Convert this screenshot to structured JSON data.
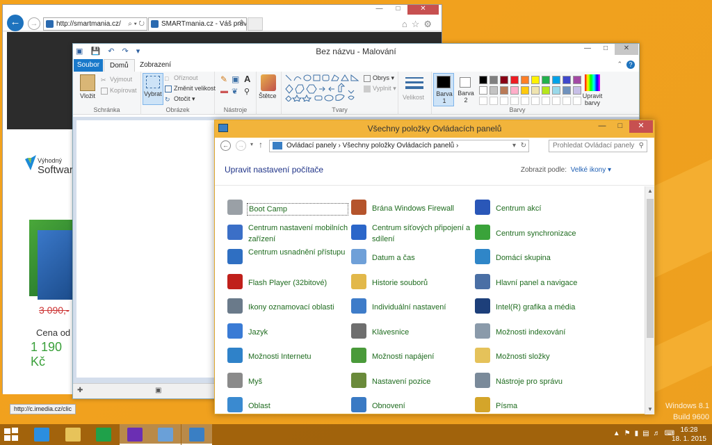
{
  "ie": {
    "address": "http://smartmania.cz/",
    "tab_title": "SMARTmania.cz - Váš prův...",
    "nav_tools": "⌕ ▾ ↻",
    "ad_small": "Výhodný",
    "ad_big": "Softwar",
    "ad_old_price": "3 090,-",
    "ad_cena": "Cena od",
    "ad_price": "1 190 Kč",
    "status_url": "http://c.imedia.cz/clic"
  },
  "paint": {
    "title": "Bez názvu - Malování",
    "tabs": {
      "file": "Soubor",
      "home": "Domů",
      "view": "Zobrazení"
    },
    "groups": {
      "clipboard": "Schránka",
      "image": "Obrázek",
      "tools": "Nástroje",
      "shapes": "Tvary",
      "colors": "Barvy"
    },
    "buttons": {
      "paste": "Vložit",
      "cut": "Vyjmout",
      "copy": "Kopírovat",
      "select": "Vybrat",
      "crop": "Oříznout",
      "resize": "Změnit velikost",
      "rotate": "Otočit",
      "brushes": "Štětce",
      "outline": "Obrys",
      "fill": "Vyplnit",
      "size": "Velikost",
      "color1": "Barva 1",
      "color2": "Barva 2",
      "edit_colors": "Upravit barvy"
    },
    "palette": [
      "#000000",
      "#7f7f7f",
      "#880015",
      "#ed1c24",
      "#ff7f27",
      "#fff200",
      "#22b14c",
      "#00a2e8",
      "#3f48cc",
      "#a349a4",
      "#ffffff",
      "#c3c3c3",
      "#b97a57",
      "#ffaec9",
      "#ffc90e",
      "#efe4b0",
      "#b5e61d",
      "#99d9ea",
      "#7092be",
      "#c8bfe7"
    ]
  },
  "control_panel": {
    "title": "Všechny položky Ovládacích panelů",
    "breadcrumb": "Ovládací panely  ›  Všechny položky Ovládacích panelů  ›",
    "search_placeholder": "Prohledat Ovládací panely",
    "heading": "Upravit nastavení počítače",
    "view_label": "Zobrazit podle:",
    "view_value": "Velké ikony ▾",
    "items": [
      {
        "label": "Boot Camp",
        "icon": "bootcamp-icon",
        "color": "#9aa0a6"
      },
      {
        "label": "Brána Windows Firewall",
        "icon": "firewall-icon",
        "color": "#b5542c"
      },
      {
        "label": "Centrum akcí",
        "icon": "action-center-icon",
        "color": "#2a57b8"
      },
      {
        "label": "Centrum nastavení mobilních zařízení",
        "icon": "mobility-center-icon",
        "color": "#3b6fc7"
      },
      {
        "label": "Centrum síťových připojení a sdílení",
        "icon": "network-icon",
        "color": "#2b66c9"
      },
      {
        "label": "Centrum synchronizace",
        "icon": "sync-icon",
        "color": "#3aa33a"
      },
      {
        "label": "Centrum usnadnění přístupu",
        "icon": "ease-of-access-icon",
        "color": "#2f6fc2"
      },
      {
        "label": "Datum a čas",
        "icon": "clock-icon",
        "color": "#6fa0d8"
      },
      {
        "label": "Domácí skupina",
        "icon": "homegroup-icon",
        "color": "#2f86c8"
      },
      {
        "label": "Flash Player (32bitové)",
        "icon": "flash-icon",
        "color": "#c0201b"
      },
      {
        "label": "Historie souborů",
        "icon": "file-history-icon",
        "color": "#e2b84a"
      },
      {
        "label": "Hlavní panel a navigace",
        "icon": "taskbar-icon",
        "color": "#4a6fa5"
      },
      {
        "label": "Ikony oznamovací oblasti",
        "icon": "notification-icons-icon",
        "color": "#6a7a8a"
      },
      {
        "label": "Individuální nastavení",
        "icon": "personalization-icon",
        "color": "#3e7cc9"
      },
      {
        "label": "Intel(R) grafika a média",
        "icon": "intel-icon",
        "color": "#1d3f7a"
      },
      {
        "label": "Jazyk",
        "icon": "language-icon",
        "color": "#3a7bd5"
      },
      {
        "label": "Klávesnice",
        "icon": "keyboard-icon",
        "color": "#6e6e6e"
      },
      {
        "label": "Možnosti indexování",
        "icon": "indexing-icon",
        "color": "#8a9aaa"
      },
      {
        "label": "Možnosti Internetu",
        "icon": "internet-options-icon",
        "color": "#2f82c9"
      },
      {
        "label": "Možnosti napájení",
        "icon": "power-icon",
        "color": "#4a9a3a"
      },
      {
        "label": "Možnosti složky",
        "icon": "folder-options-icon",
        "color": "#e5c25a"
      },
      {
        "label": "Myš",
        "icon": "mouse-icon",
        "color": "#8a8a8a"
      },
      {
        "label": "Nastavení pozice",
        "icon": "location-icon",
        "color": "#6a8a3a"
      },
      {
        "label": "Nástroje pro správu",
        "icon": "admin-tools-icon",
        "color": "#7a8a9a"
      },
      {
        "label": "Oblast",
        "icon": "region-icon",
        "color": "#3a8ad0"
      },
      {
        "label": "Obnovení",
        "icon": "recovery-icon",
        "color": "#3a7ac4"
      },
      {
        "label": "Písma",
        "icon": "fonts-icon",
        "color": "#d4a52a"
      }
    ]
  },
  "taskbar": {
    "apps": [
      {
        "name": "internet-explorer",
        "color": "#2b8ee0"
      },
      {
        "name": "file-explorer",
        "color": "#e7c35a"
      },
      {
        "name": "store",
        "color": "#1fa14a"
      },
      {
        "name": "settings",
        "color": "#6b2fb3"
      },
      {
        "name": "paint",
        "color": "#6aa0d8"
      },
      {
        "name": "control-panel",
        "color": "#3a7fc4"
      }
    ],
    "time": "16:28",
    "date": "18. 1. 2015"
  },
  "desktop": {
    "os_name": "Windows 8.1",
    "build": "Build 9600"
  }
}
